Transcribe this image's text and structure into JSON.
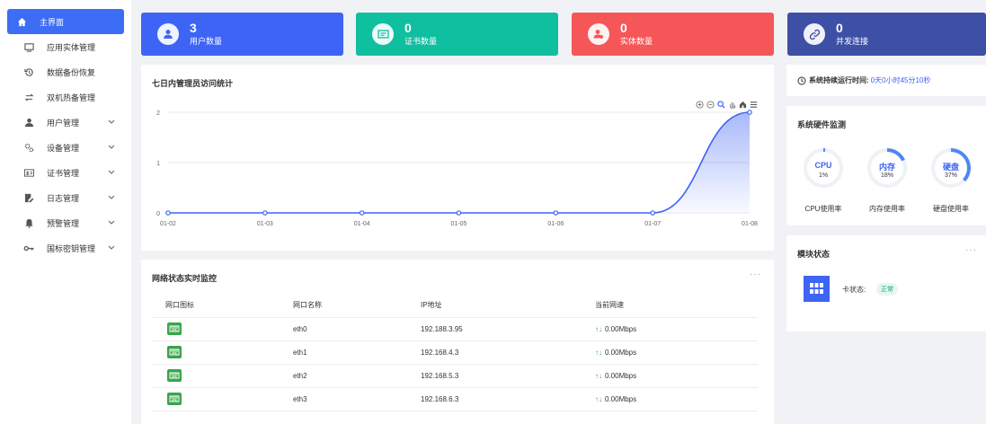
{
  "sidebar": {
    "items": [
      {
        "label": "主界面",
        "icon": "home-icon",
        "active": true,
        "has_children": false
      },
      {
        "label": "应用实体管理",
        "icon": "monitor-icon",
        "active": false,
        "has_children": false
      },
      {
        "label": "数据备份恢复",
        "icon": "restore-icon",
        "active": false,
        "has_children": false
      },
      {
        "label": "双机热备管理",
        "icon": "swap-icon",
        "active": false,
        "has_children": false
      },
      {
        "label": "用户管理",
        "icon": "user-icon",
        "active": false,
        "has_children": true
      },
      {
        "label": "设备管理",
        "icon": "gears-icon",
        "active": false,
        "has_children": true
      },
      {
        "label": "证书管理",
        "icon": "id-card-icon",
        "active": false,
        "has_children": true
      },
      {
        "label": "日志管理",
        "icon": "log-edit-icon",
        "active": false,
        "has_children": true
      },
      {
        "label": "预警管理",
        "icon": "bell-icon",
        "active": false,
        "has_children": true
      },
      {
        "label": "国标密钥管理",
        "icon": "key-icon",
        "active": false,
        "has_children": true
      }
    ]
  },
  "stats": [
    {
      "value": "3",
      "label": "用户数量",
      "color": "#3d64f5",
      "icon": "user-icon"
    },
    {
      "value": "0",
      "label": "证书数量",
      "color": "#10bfa0",
      "icon": "certificate-icon"
    },
    {
      "value": "0",
      "label": "实体数量",
      "color": "#f55658",
      "icon": "entity-user-icon"
    },
    {
      "value": "0",
      "label": "并发连接",
      "color": "#3e4fa6",
      "icon": "link-icon"
    }
  ],
  "chart_panel": {
    "title": "七日内管理员访问统计"
  },
  "chart_data": {
    "type": "area",
    "title": "七日内管理员访问统计",
    "categories": [
      "01-02",
      "01-03",
      "01-04",
      "01-05",
      "01-06",
      "01-07",
      "01-08"
    ],
    "values": [
      0,
      0,
      0,
      0,
      0,
      0,
      2
    ],
    "ylim": [
      0,
      2
    ],
    "yticks": [
      "0",
      "1",
      "2"
    ],
    "grid": true,
    "line_color": "#3d64f5"
  },
  "uptime": {
    "label": "系统持续运行时间:",
    "value": "0天0小时45分10秒"
  },
  "hardware": {
    "title": "系统硬件监测",
    "gauges": [
      {
        "name": "CPU",
        "percent": "1%",
        "fraction": 0.01,
        "caption": "CPU使用率"
      },
      {
        "name": "内存",
        "percent": "18%",
        "fraction": 0.18,
        "caption": "内存使用率"
      },
      {
        "name": "硬盘",
        "percent": "37%",
        "fraction": 0.37,
        "caption": "硬盘使用率"
      }
    ],
    "gauge_color": "#4f86f7",
    "track_color": "#eef1f6"
  },
  "module": {
    "title": "模块状态",
    "card_label": "卡状态:",
    "status": "正常"
  },
  "network": {
    "title": "网络状态实时监控",
    "columns": [
      "网口图标",
      "网口名称",
      "IP地址",
      "当前网速"
    ],
    "rows": [
      {
        "name": "eth0",
        "ip": "192.188.3.95",
        "speed": "0.00Mbps"
      },
      {
        "name": "eth1",
        "ip": "192.168.4.3",
        "speed": "0.00Mbps"
      },
      {
        "name": "eth2",
        "ip": "192.168.5.3",
        "speed": "0.00Mbps"
      },
      {
        "name": "eth3",
        "ip": "192.168.6.3",
        "speed": "0.00Mbps"
      }
    ]
  },
  "more_label": "···"
}
